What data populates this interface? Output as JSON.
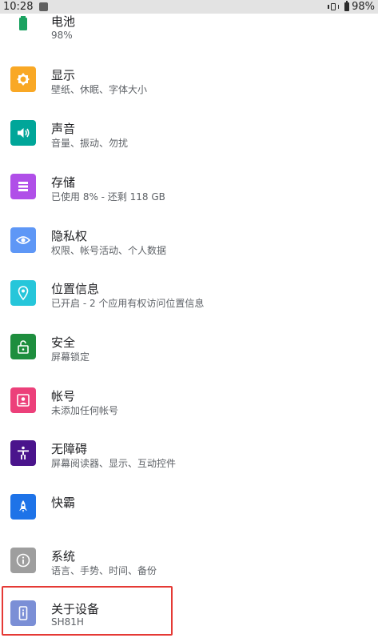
{
  "status_bar": {
    "time": "10:28",
    "battery_text": "98%"
  },
  "settings": {
    "items": [
      {
        "key": "battery",
        "title": "电池",
        "subtitle": "98%",
        "icon": "battery-icon",
        "color": "#1aa260"
      },
      {
        "key": "display",
        "title": "显示",
        "subtitle": "壁纸、休眠、字体大小",
        "icon": "brightness-icon",
        "color": "#f9a825"
      },
      {
        "key": "sound",
        "title": "声音",
        "subtitle": "音量、振动、勿扰",
        "icon": "volume-icon",
        "color": "#00a699"
      },
      {
        "key": "storage",
        "title": "存储",
        "subtitle": "已使用 8% - 还剩 118 GB",
        "icon": "storage-icon",
        "color": "#b04fe8"
      },
      {
        "key": "privacy",
        "title": "隐私权",
        "subtitle": "权限、帐号活动、个人数据",
        "icon": "privacy-eye-icon",
        "color": "#5e97f6"
      },
      {
        "key": "location",
        "title": "位置信息",
        "subtitle": "已开启 - 2 个应用有权访问位置信息",
        "icon": "location-pin-icon",
        "color": "#26c6da"
      },
      {
        "key": "security",
        "title": "安全",
        "subtitle": "屏幕锁定",
        "icon": "lock-icon",
        "color": "#1e8e3e"
      },
      {
        "key": "accounts",
        "title": "帐号",
        "subtitle": "未添加任何帐号",
        "icon": "account-icon",
        "color": "#ec407a"
      },
      {
        "key": "accessibility",
        "title": "无障碍",
        "subtitle": "屏幕阅读器、显示、互动控件",
        "icon": "accessibility-icon",
        "color": "#4a148c"
      },
      {
        "key": "kuaiba",
        "title": "快霸",
        "subtitle": "",
        "icon": "rocket-icon",
        "color": "#1e73e8"
      },
      {
        "key": "system",
        "title": "系统",
        "subtitle": "语言、手势、时间、备份",
        "icon": "info-icon",
        "color": "#9e9e9e"
      },
      {
        "key": "about",
        "title": "关于设备",
        "subtitle": "SH81H",
        "icon": "phone-info-icon",
        "color": "#7b8fd6"
      }
    ]
  }
}
